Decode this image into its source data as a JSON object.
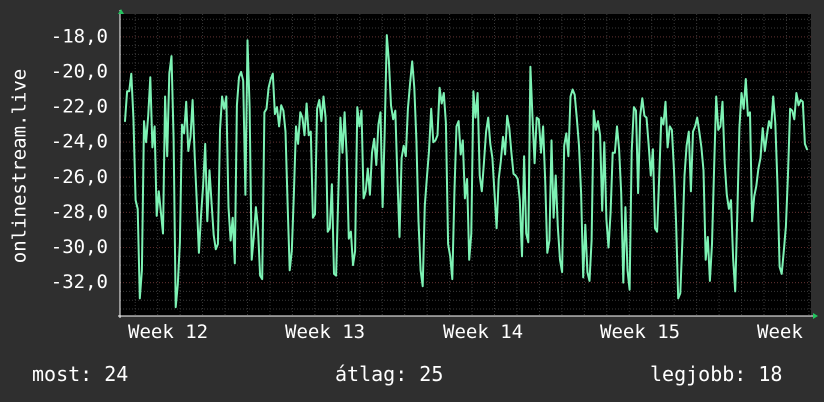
{
  "chart_data": {
    "type": "line",
    "ylabel": "onlinestream.live",
    "ylim": [
      -33.9,
      -16.7
    ],
    "y_ticks": [
      -18.0,
      -20.0,
      -22.0,
      -24.0,
      -26.0,
      -28.0,
      -30.0,
      -32.0
    ],
    "y_tick_labels": [
      "-18,0",
      "-20,0",
      "-22,0",
      "-24,0",
      "-26,0",
      "-28,0",
      "-30,0",
      "-32,0"
    ],
    "x_tick_labels": [
      "Week 12",
      "Week 13",
      "Week 14",
      "Week 15",
      "Week"
    ],
    "grid": true,
    "series_color": "#7df2b4",
    "background_color": "#2f2f2f",
    "plot_background_color": "#000000",
    "grid_color": "#5a2a2a",
    "y": [
      -22.8,
      -21.1,
      -21.1,
      -20.1,
      -22.6,
      -27.3,
      -27.8,
      -32.9,
      -31.3,
      -22.8,
      -24.0,
      -22.5,
      -20.3,
      -24.3,
      -23.1,
      -28.2,
      -26.8,
      -28.0,
      -29.2,
      -21.4,
      -24.8,
      -20.1,
      -19.1,
      -23.8,
      -33.4,
      -32.1,
      -29.7,
      -23.0,
      -23.5,
      -21.7,
      -24.5,
      -23.7,
      -21.6,
      -24.8,
      -27.4,
      -30.3,
      -28.2,
      -26.5,
      -24.1,
      -28.5,
      -25.6,
      -27.5,
      -29.3,
      -30.1,
      -29.8,
      -23.3,
      -21.4,
      -22.1,
      -21.4,
      -27.7,
      -29.6,
      -28.3,
      -30.9,
      -21.9,
      -20.3,
      -20.0,
      -20.5,
      -27.0,
      -18.2,
      -22.0,
      -30.7,
      -29.4,
      -27.7,
      -28.9,
      -31.6,
      -31.8,
      -22.3,
      -22.1,
      -20.9,
      -20.4,
      -20.1,
      -22.4,
      -22.0,
      -23.1,
      -21.9,
      -22.2,
      -23.4,
      -27.5,
      -31.3,
      -30.2,
      -26.9,
      -23.1,
      -24.1,
      -22.3,
      -22.6,
      -23.6,
      -21.8,
      -23.6,
      -23.4,
      -28.3,
      -28.1,
      -22.1,
      -21.6,
      -22.8,
      -21.4,
      -22.6,
      -29.1,
      -28.9,
      -26.4,
      -31.5,
      -31.6,
      -27.0,
      -22.6,
      -24.6,
      -22.3,
      -24.8,
      -29.5,
      -29.1,
      -31.0,
      -30.2,
      -22.0,
      -23.1,
      -22.2,
      -27.2,
      -26.8,
      -25.5,
      -27.0,
      -24.6,
      -23.8,
      -25.3,
      -23.0,
      -22.3,
      -27.7,
      -23.4,
      -17.9,
      -19.4,
      -21.9,
      -22.7,
      -22.2,
      -26.0,
      -29.4,
      -24.9,
      -24.2,
      -24.8,
      -22.1,
      -20.7,
      -19.4,
      -20.9,
      -23.9,
      -28.5,
      -31.3,
      -32.2,
      -27.6,
      -26.0,
      -24.5,
      -22.1,
      -24.0,
      -23.9,
      -23.6,
      -20.9,
      -21.8,
      -21.2,
      -22.9,
      -29.8,
      -30.5,
      -31.8,
      -26.9,
      -23.1,
      -22.8,
      -24.7,
      -23.9,
      -27.2,
      -26.1,
      -30.7,
      -29.2,
      -21.1,
      -22.6,
      -21.2,
      -25.9,
      -26.8,
      -25.2,
      -23.4,
      -22.6,
      -24.1,
      -24.9,
      -26.9,
      -28.9,
      -26.1,
      -25.1,
      -23.7,
      -24.7,
      -22.5,
      -23.2,
      -24.6,
      -25.8,
      -25.9,
      -26.1,
      -27.3,
      -30.5,
      -24.8,
      -29.2,
      -29.7,
      -19.7,
      -22.6,
      -25.2,
      -22.6,
      -22.7,
      -24.6,
      -23.1,
      -26.2,
      -30.3,
      -29.6,
      -23.9,
      -28.3,
      -25.9,
      -28.8,
      -30.7,
      -31.4,
      -24.2,
      -23.5,
      -24.8,
      -21.4,
      -21.0,
      -21.3,
      -22.7,
      -24.2,
      -26.9,
      -31.7,
      -28.7,
      -31.4,
      -31.9,
      -29.6,
      -22.2,
      -23.3,
      -22.8,
      -23.6,
      -27.9,
      -24.0,
      -28.4,
      -30.0,
      -28.0,
      -24.6,
      -24.6,
      -23.1,
      -24.4,
      -26.9,
      -32.0,
      -27.7,
      -31.3,
      -32.4,
      -24.5,
      -22.0,
      -22.2,
      -26.9,
      -22.5,
      -21.5,
      -22.5,
      -22.6,
      -24.1,
      -25.9,
      -24.4,
      -28.9,
      -29.1,
      -26.0,
      -22.6,
      -23.0,
      -21.7,
      -24.3,
      -23.1,
      -23.3,
      -25.6,
      -28.6,
      -32.9,
      -32.6,
      -29.6,
      -25.9,
      -24.2,
      -23.4,
      -26.8,
      -23.4,
      -23.1,
      -22.6,
      -23.4,
      -24.3,
      -25.6,
      -30.7,
      -29.4,
      -31.9,
      -29.8,
      -25.5,
      -21.4,
      -23.3,
      -23.1,
      -21.7,
      -25.2,
      -27.0,
      -27.8,
      -27.3,
      -30.6,
      -32.5,
      -28.1,
      -23.2,
      -21.2,
      -22.1,
      -20.4,
      -22.5,
      -22.3,
      -28.5,
      -27.1,
      -26.5,
      -25.5,
      -24.9,
      -23.2,
      -24.5,
      -23.6,
      -22.8,
      -23.2,
      -21.4,
      -22.9,
      -26.3,
      -31.1,
      -31.5,
      -30.2,
      -28.8,
      -25.8,
      -22.1,
      -22.2,
      -22.7,
      -21.2,
      -21.9,
      -21.6,
      -21.7,
      -24.1,
      -24.4
    ]
  },
  "stats": {
    "now": "most: 24",
    "avg": "átlag: 25",
    "best": "legjobb: 18"
  }
}
